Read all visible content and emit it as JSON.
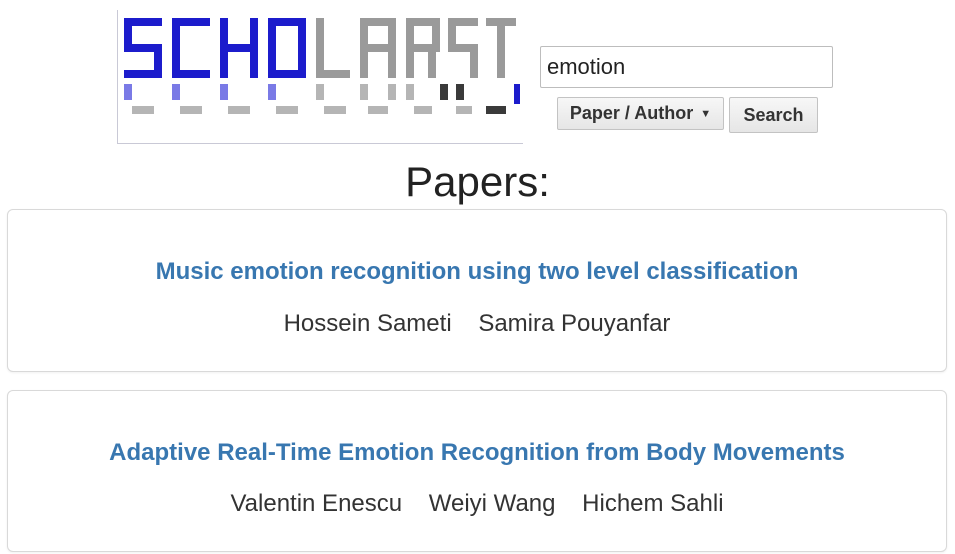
{
  "header": {
    "logo_alt": "SCHOLARSNET",
    "search": {
      "value": "emotion",
      "placeholder": ""
    },
    "filter_select": {
      "selected": "Paper / Author"
    },
    "search_button_label": "Search"
  },
  "main": {
    "section_title": "Papers:",
    "papers": [
      {
        "title": "Music emotion recognition using two level classification",
        "authors": [
          "Hossein Sameti",
          "Samira Pouyanfar"
        ]
      },
      {
        "title": "Adaptive Real-Time Emotion Recognition from Body Movements",
        "authors": [
          "Valentin Enescu",
          "Weiyi Wang",
          "Hichem Sahli"
        ]
      }
    ]
  },
  "colors": {
    "link": "#3877b0",
    "logo_blue": "#1c1ccc",
    "logo_gray": "#9a9a9a"
  }
}
